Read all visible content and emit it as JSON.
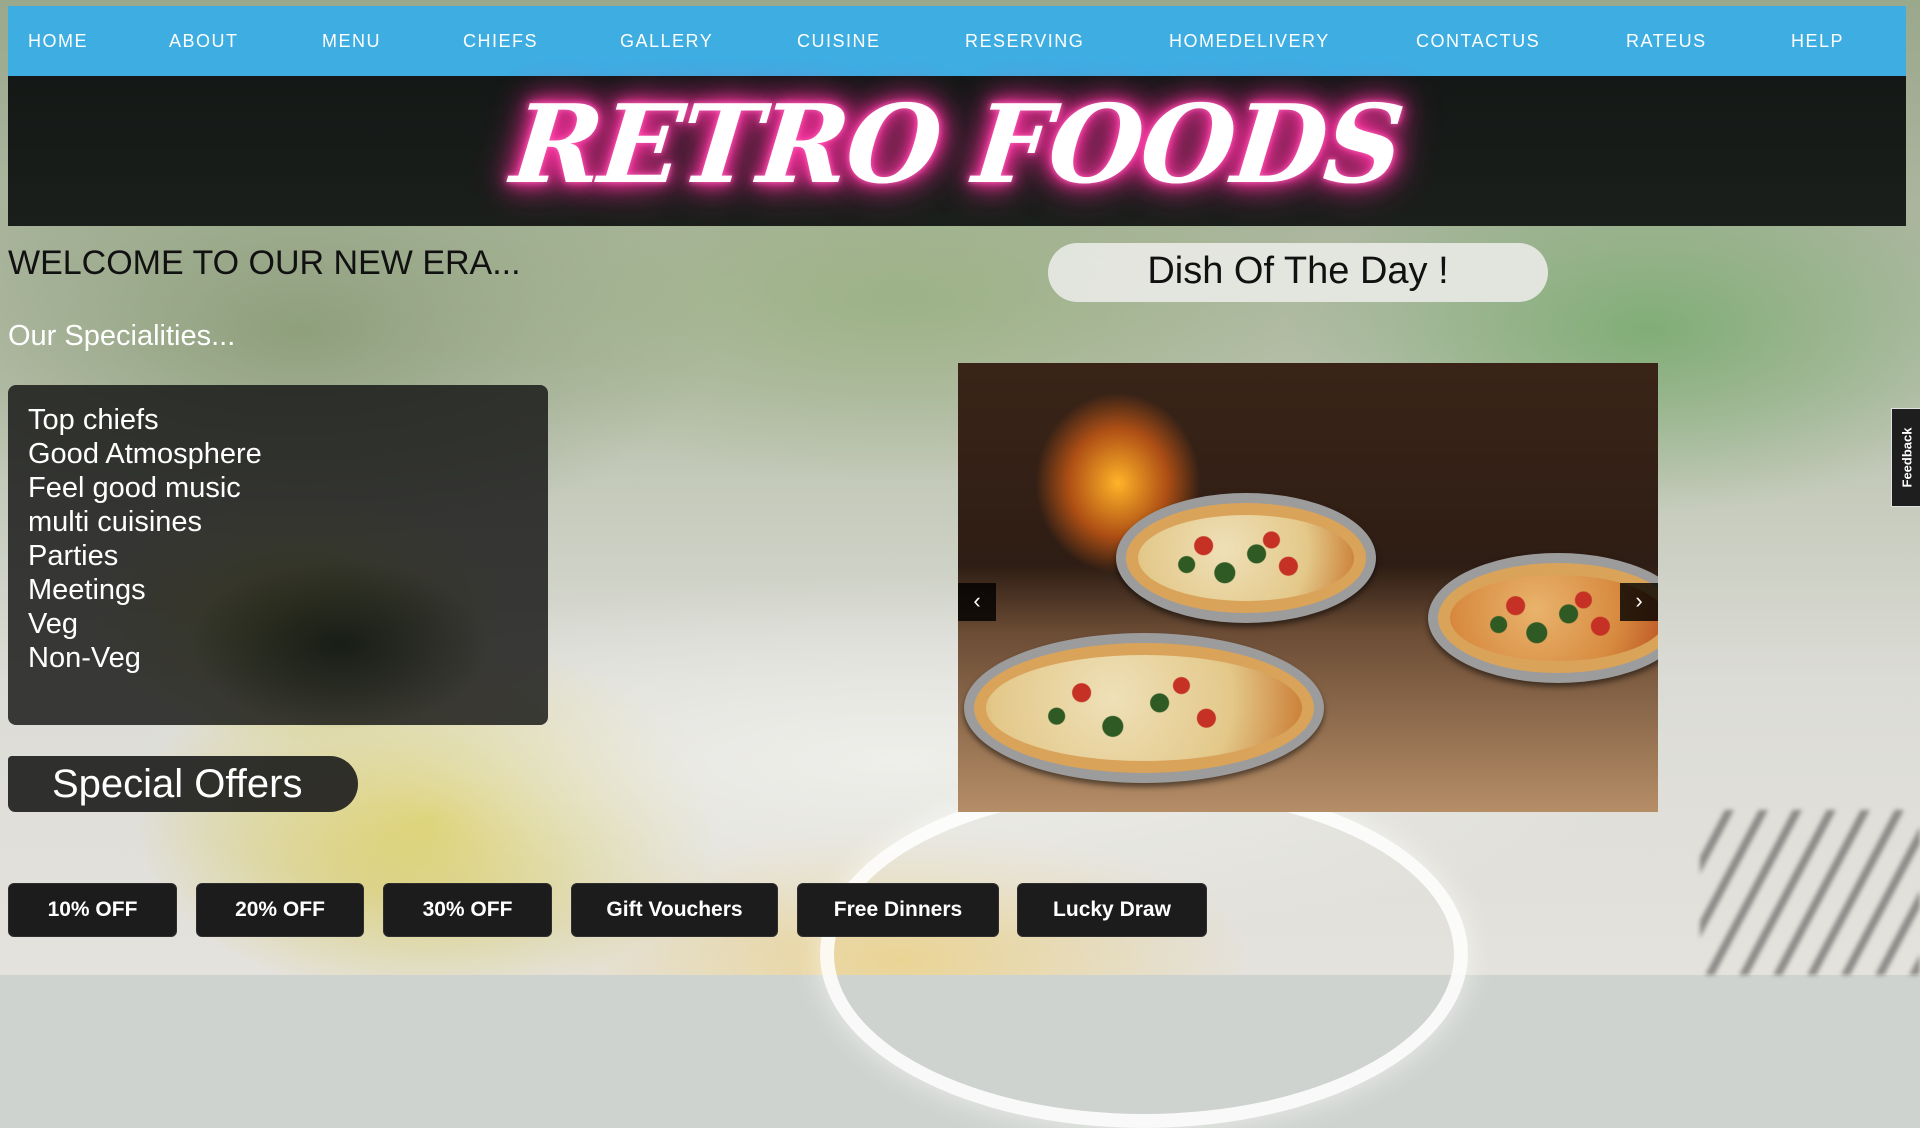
{
  "nav": {
    "items": [
      "HOME",
      "ABOUT",
      "MENU",
      "CHIEFS",
      "GALLERY",
      "CUISINE",
      "RESERVING",
      "HOMEDELIVERY",
      "CONTACTUS",
      "RATEUS",
      "HELP"
    ]
  },
  "banner": {
    "logo_text": "RETRO FOODS"
  },
  "welcome": {
    "heading": "WELCOME TO OUR NEW ERA..."
  },
  "specialities": {
    "heading": "Our Specialities...",
    "items": [
      "Top chiefs",
      "Good Atmosphere",
      "Feel good music",
      "multi cuisines",
      "Parties",
      "Meetings",
      "Veg",
      "Non-Veg"
    ]
  },
  "offers": {
    "title": "Special Offers",
    "buttons": [
      "10% OFF",
      "20% OFF",
      "30% OFF",
      "Gift Vouchers",
      "Free Dinners",
      "Lucky Draw"
    ]
  },
  "dish_of_day": {
    "title": "Dish Of The Day !",
    "prev_label": "‹",
    "next_label": "›"
  },
  "feedback": {
    "label": "Feedback"
  },
  "colors": {
    "nav_bg": "#3eaee2",
    "banner_bg": "#141816",
    "logo_glow": "#ff2d9d",
    "button_bg": "#1c1c1c"
  }
}
